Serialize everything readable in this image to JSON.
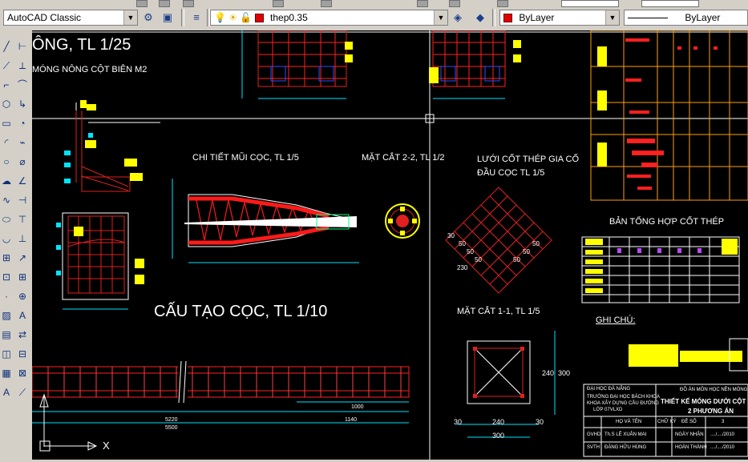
{
  "toolbar": {
    "workspace": "AutoCAD Classic",
    "layer": "thep0.35",
    "color": "ByLayer",
    "linetype": "ByLayer"
  },
  "drawing": {
    "title_top_left": "ÔNG, TL 1/25",
    "subtitle_top_left": "MÓNG NÔNG CỘT BIÊN M2",
    "detail_tip": "CHI TIẾT MŨI CỌC, TL 1/5",
    "section_22": "MẶT CẮT 2-2, TL 1/2",
    "mesh_title_1": "LƯỚI CỐT THÉP GIA CỐ",
    "mesh_title_2": "ĐẦU CỌC TL 1/5",
    "rebar_summary": "BẢN TỔNG HỢP CỐT THÉP",
    "pile_structure": "CẤU TẠO CỌC, TL 1/10",
    "section_11": "MẶT CẮT 1-1, TL 1/5",
    "notes": "GHI CHÚ:",
    "dim_5220": "5220",
    "dim_1140": "1140",
    "dim_5500": "5500",
    "dim_1000": "1000",
    "dim_240": "240",
    "dim_300": "300",
    "dim_30a": "30",
    "dim_30b": "30",
    "dim_240v": "240",
    "dim_300v": "300",
    "mesh_labels": [
      "30",
      "50",
      "50",
      "50",
      "50",
      "50",
      "50",
      "230"
    ],
    "title_block": {
      "school_1": "ĐẠI HỌC ĐÀ NẴNG",
      "school_2": "TRƯỜNG ĐẠI HỌC BÁCH KHOA",
      "school_3": "KHOA XÂY DỰNG CẦU ĐƯỜNG",
      "school_4": "LỚP 07VLXD",
      "project": "ĐỒ ÁN MÔN HỌC NỀN MÓNG",
      "design": "THIẾT KẾ MÓNG DƯỚI CỘT TH",
      "option": "2 PHƯƠNG ÁN",
      "col_name": "HỌ VÀ TÊN",
      "col_sign": "CHỮ KÝ",
      "col_no": "ĐỀ SỐ",
      "no_value": "3",
      "gvhd": "GVHD",
      "teacher": "Th.S LÊ XUÂN MAI",
      "received": "NGÀY NHẬN",
      "date1": "..../..../2010",
      "svth": "SVTH",
      "student": "ĐẶNG HỮU HÙNG",
      "done": "HOÀN THÀNH",
      "date2": "..../..../2010"
    }
  },
  "ucs": {
    "x_label": "X"
  }
}
